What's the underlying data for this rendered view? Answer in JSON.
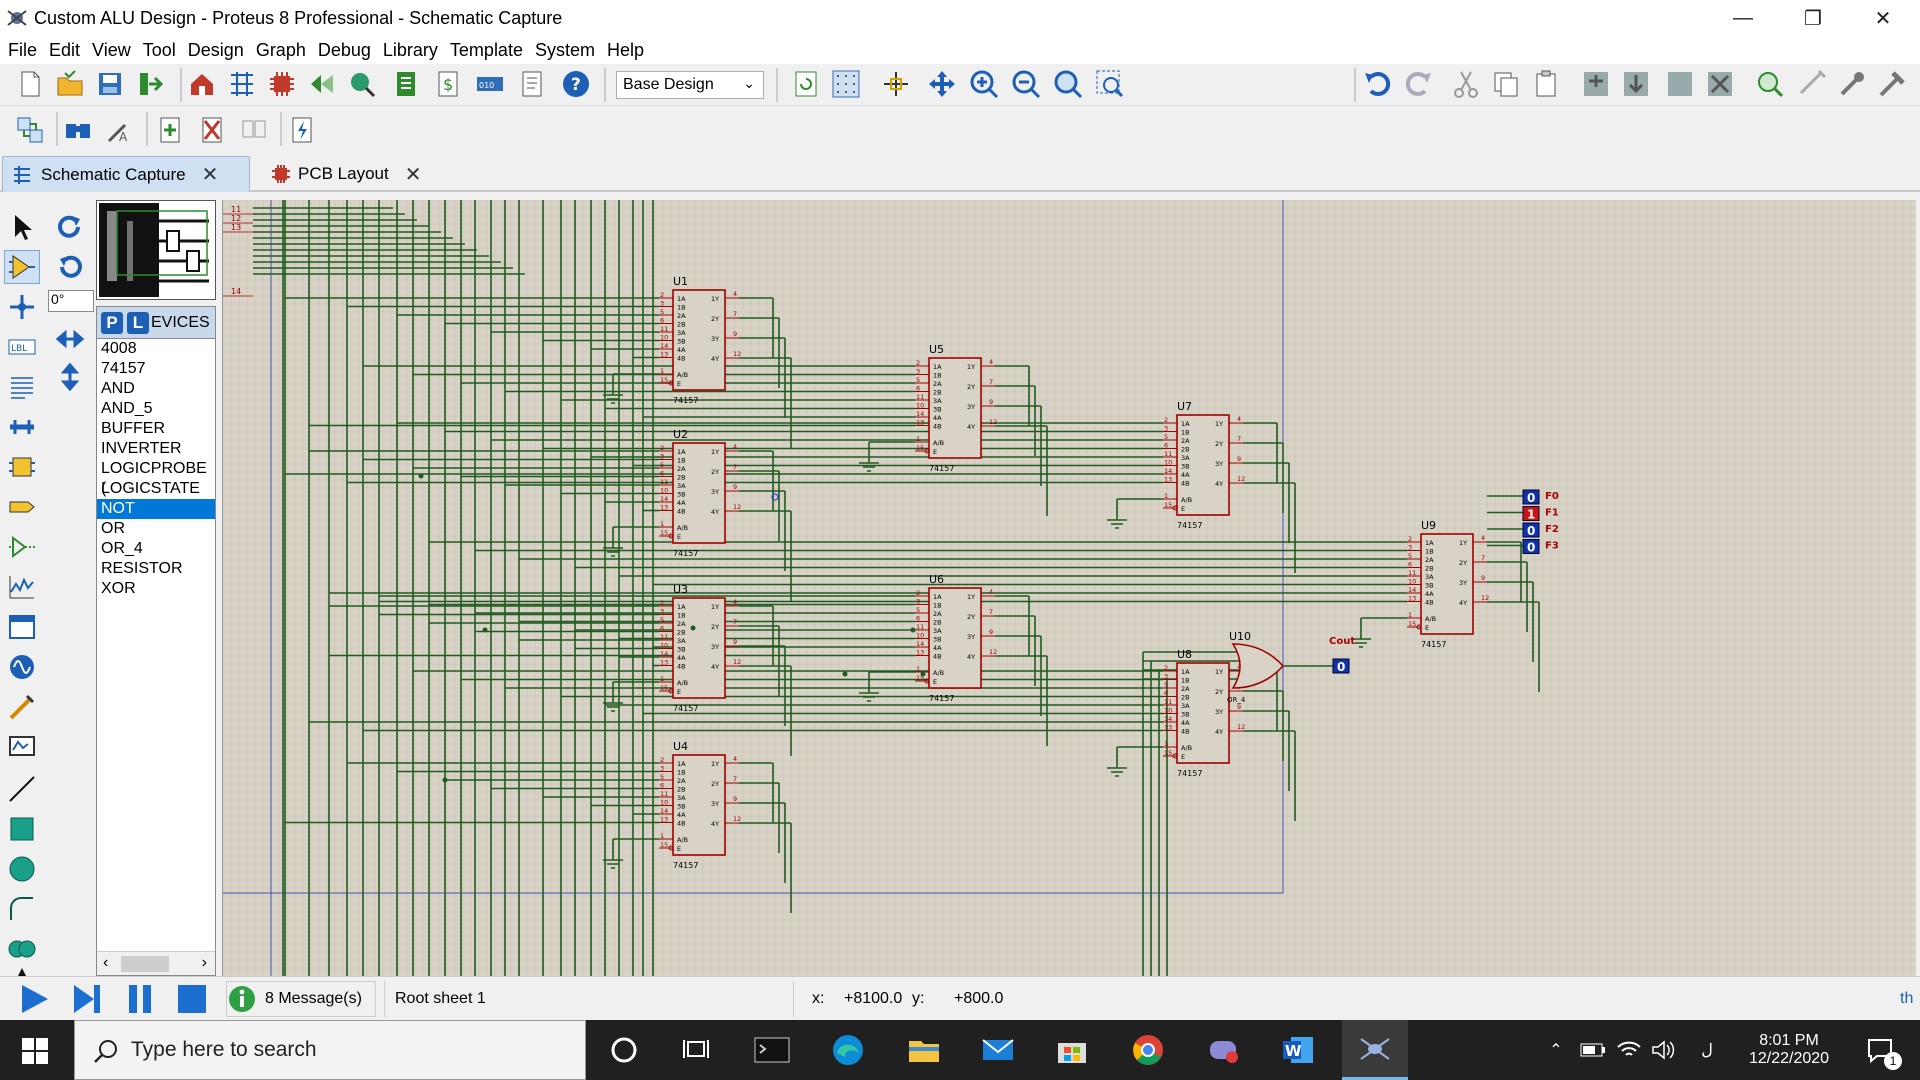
{
  "window": {
    "title": "Custom ALU Design - Proteus 8 Professional - Schematic Capture"
  },
  "menu": [
    "File",
    "Edit",
    "View",
    "Tool",
    "Design",
    "Graph",
    "Debug",
    "Library",
    "Template",
    "System",
    "Help"
  ],
  "toolbar": {
    "variant_select": "Base Design"
  },
  "tabs": [
    {
      "label": "Schematic Capture"
    },
    {
      "label": "PCB Layout"
    }
  ],
  "sidebar": {
    "rotation": "0°",
    "devices_header": "EVICES",
    "pick_label": "P",
    "library_label": "L",
    "devices": [
      "4008",
      "74157",
      "AND",
      "AND_5",
      "BUFFER",
      "INVERTER",
      "LOGICPROBE (",
      "LOGICSTATE",
      "NOT",
      "OR",
      "OR_4",
      "RESISTOR",
      "XOR"
    ],
    "selected_device": "NOT"
  },
  "schematic": {
    "muxes": [
      {
        "ref": "U1",
        "part": "74157"
      },
      {
        "ref": "U2",
        "part": "74157"
      },
      {
        "ref": "U3",
        "part": "74157"
      },
      {
        "ref": "U4",
        "part": "74157"
      },
      {
        "ref": "U5",
        "part": "74157"
      },
      {
        "ref": "U6",
        "part": "74157"
      },
      {
        "ref": "U7",
        "part": "74157"
      },
      {
        "ref": "U8",
        "part": "74157"
      },
      {
        "ref": "U9",
        "part": "74157"
      }
    ],
    "left_pins": [
      "1A",
      "1B",
      "2A",
      "2B",
      "3A",
      "3B",
      "4A",
      "4B"
    ],
    "right_pins": [
      "1Y",
      "2Y",
      "3Y",
      "4Y"
    ],
    "pin_numbers_left": [
      "2",
      "3",
      "5",
      "6",
      "11",
      "10",
      "14",
      "13"
    ],
    "pin_numbers_right": [
      "4",
      "7",
      "9",
      "12"
    ],
    "ctrl_pins": [
      "A/B",
      "E"
    ],
    "ctrl_pin_numbers": [
      "1",
      "15"
    ],
    "or_gate": {
      "ref": "U10",
      "part": "OR_4"
    },
    "outputs": [
      {
        "label": "F0",
        "value": "0"
      },
      {
        "label": "F1",
        "value": "1"
      },
      {
        "label": "F2",
        "value": "0"
      },
      {
        "label": "F3",
        "value": "0"
      }
    ],
    "cout": {
      "label": "Cout",
      "value": "0"
    },
    "edge_numbers": [
      "11",
      "12",
      "13",
      "14"
    ]
  },
  "status": {
    "messages": "8 Message(s)",
    "sheet": "Root sheet 1",
    "x_label": "x:",
    "x_value": "+8100.0",
    "y_label": "y:",
    "y_value": "+800.0",
    "right_text": "th"
  },
  "taskbar": {
    "search_placeholder": "Type here to search",
    "time": "8:01 PM",
    "date": "12/22/2020",
    "lang": "ل",
    "notif_count": "1"
  },
  "colors": {
    "wire": "#1f5a1f",
    "component": "#a00000",
    "canvas": "#d8d3c6",
    "grid": "#c7c2b3",
    "probe_on": "#c81414",
    "probe_off": "#1133aa"
  }
}
